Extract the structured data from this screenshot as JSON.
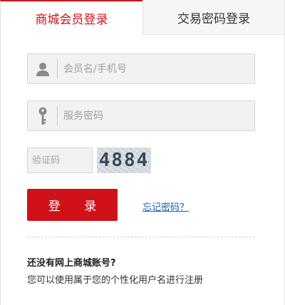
{
  "tabs": {
    "member_login": "商城会员登录",
    "trade_login": "交易密码登录"
  },
  "form": {
    "username_placeholder": "会员名/手机号",
    "password_placeholder": "服务密码",
    "captcha_placeholder": "验证码",
    "captcha_code": "4884",
    "login_label": "登 录",
    "forgot_label": "忘记密码？"
  },
  "register": {
    "no_account": "还没有网上商城账号?",
    "hint": "您可以使用属于您的个性化用户名进行注册"
  },
  "colors": {
    "accent": "#c8161d",
    "button": "#cf1219",
    "link": "#1a5fb4"
  },
  "icons": {
    "username": "user-icon",
    "password": "key-icon"
  }
}
